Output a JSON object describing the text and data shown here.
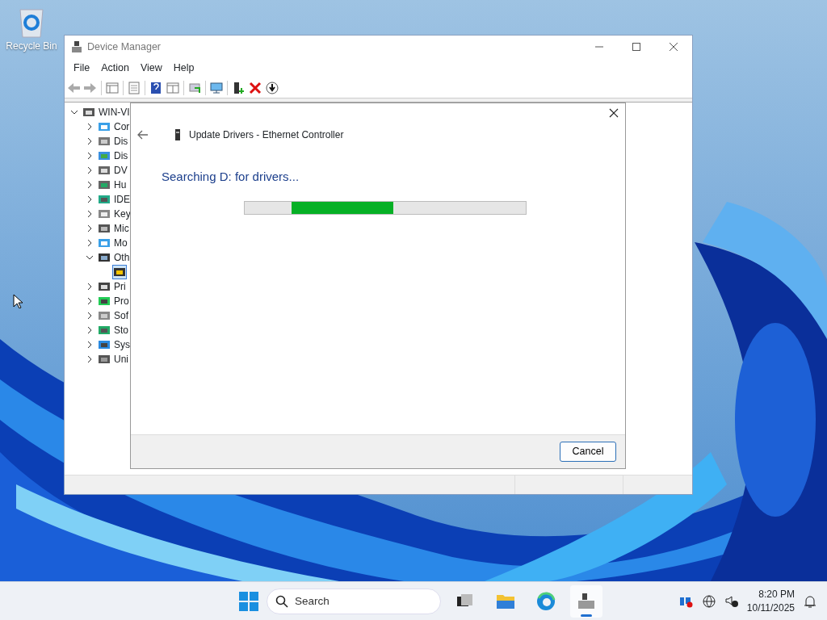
{
  "desktop": {
    "icons": [
      {
        "label": "Recycle Bin"
      }
    ]
  },
  "window": {
    "title": "Device Manager",
    "menu": [
      "File",
      "Action",
      "View",
      "Help"
    ],
    "toolbar": [
      {
        "kind": "back"
      },
      {
        "kind": "forward"
      },
      {
        "kind": "sep"
      },
      {
        "kind": "panel"
      },
      {
        "kind": "sep"
      },
      {
        "kind": "sheet"
      },
      {
        "kind": "sep"
      },
      {
        "kind": "help"
      },
      {
        "kind": "panel2"
      },
      {
        "kind": "sep"
      },
      {
        "kind": "scan"
      },
      {
        "kind": "sep"
      },
      {
        "kind": "monitor"
      },
      {
        "kind": "sep"
      },
      {
        "kind": "add"
      },
      {
        "kind": "delete"
      },
      {
        "kind": "download"
      }
    ],
    "tree": {
      "label": "WIN-VI",
      "kind": "computer",
      "expanded": true,
      "children": [
        {
          "label": "Cor",
          "kind": "monitor",
          "expanded": false
        },
        {
          "label": "Dis",
          "kind": "drive",
          "expanded": false
        },
        {
          "label": "Dis",
          "kind": "display",
          "expanded": false
        },
        {
          "label": "DV",
          "kind": "dvd",
          "expanded": false
        },
        {
          "label": "Hu",
          "kind": "hid",
          "expanded": false
        },
        {
          "label": "IDE",
          "kind": "ide",
          "expanded": false
        },
        {
          "label": "Key",
          "kind": "keyboard",
          "expanded": false
        },
        {
          "label": "Mic",
          "kind": "mouse",
          "expanded": false
        },
        {
          "label": "Mo",
          "kind": "monitor",
          "expanded": false
        },
        {
          "label": "Oth",
          "kind": "other",
          "expanded": true,
          "children": [
            {
              "kind": "warning",
              "selected": true
            }
          ]
        },
        {
          "label": "Pri",
          "kind": "printer",
          "expanded": false
        },
        {
          "label": "Pro",
          "kind": "chip",
          "expanded": false
        },
        {
          "label": "Sof",
          "kind": "soft",
          "expanded": false
        },
        {
          "label": "Sto",
          "kind": "storage",
          "expanded": false
        },
        {
          "label": "Sys",
          "kind": "system",
          "expanded": false
        },
        {
          "label": "Uni",
          "kind": "usb",
          "expanded": false
        }
      ]
    }
  },
  "dialog": {
    "title": "Update Drivers - Ethernet Controller",
    "status": "Searching D: for drivers...",
    "progress": {
      "level": 0.36
    },
    "buttons": [
      "Cancel"
    ]
  },
  "taskbar": {
    "search": {
      "placeholder": "Search"
    },
    "apps": [
      {
        "kind": "taskview",
        "active": false
      },
      {
        "kind": "folder",
        "active": false
      },
      {
        "kind": "browser",
        "active": false
      },
      {
        "kind": "devmgr",
        "active": true
      }
    ],
    "tray": {
      "time": "8:20 PM",
      "date": "10/11/2025"
    }
  }
}
